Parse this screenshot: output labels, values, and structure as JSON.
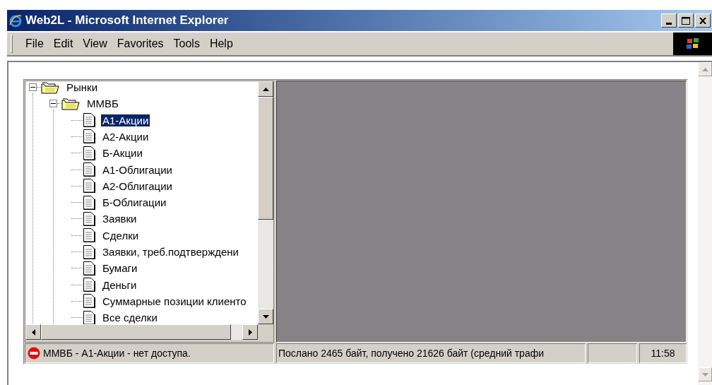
{
  "window": {
    "title": "Web2L - Microsoft Internet Explorer"
  },
  "menu": [
    "File",
    "Edit",
    "View",
    "Favorites",
    "Tools",
    "Help"
  ],
  "tree": [
    {
      "label": "Рынки",
      "kind": "folder",
      "expanded": true,
      "selected": false,
      "children": [
        {
          "label": "ММВБ",
          "kind": "folder",
          "expanded": true,
          "selected": false,
          "children": [
            {
              "label": "А1-Акции",
              "kind": "document",
              "selected": true
            },
            {
              "label": "А2-Акции",
              "kind": "document",
              "selected": false
            },
            {
              "label": "Б-Акции",
              "kind": "document",
              "selected": false
            },
            {
              "label": "А1-Облигации",
              "kind": "document",
              "selected": false
            },
            {
              "label": "А2-Облигации",
              "kind": "document",
              "selected": false
            },
            {
              "label": "Б-Облигации",
              "kind": "document",
              "selected": false
            },
            {
              "label": "Заявки",
              "kind": "document",
              "selected": false
            },
            {
              "label": "Сделки",
              "kind": "document",
              "selected": false
            },
            {
              "label": "Заявки, треб.подтверждени",
              "kind": "document",
              "selected": false
            },
            {
              "label": "Бумаги",
              "kind": "document",
              "selected": false
            },
            {
              "label": "Деньги",
              "kind": "document",
              "selected": false
            },
            {
              "label": "Суммарные позиции клиенто",
              "kind": "document",
              "selected": false
            },
            {
              "label": "Все сделки",
              "kind": "document",
              "selected": false
            }
          ]
        }
      ]
    }
  ],
  "status_bar": {
    "message": "ММВБ - А1-Акции - нет доступа.",
    "traffic": "Послано 2465 байт, получено 21626 байт (средний трафи",
    "time": "11:58"
  }
}
